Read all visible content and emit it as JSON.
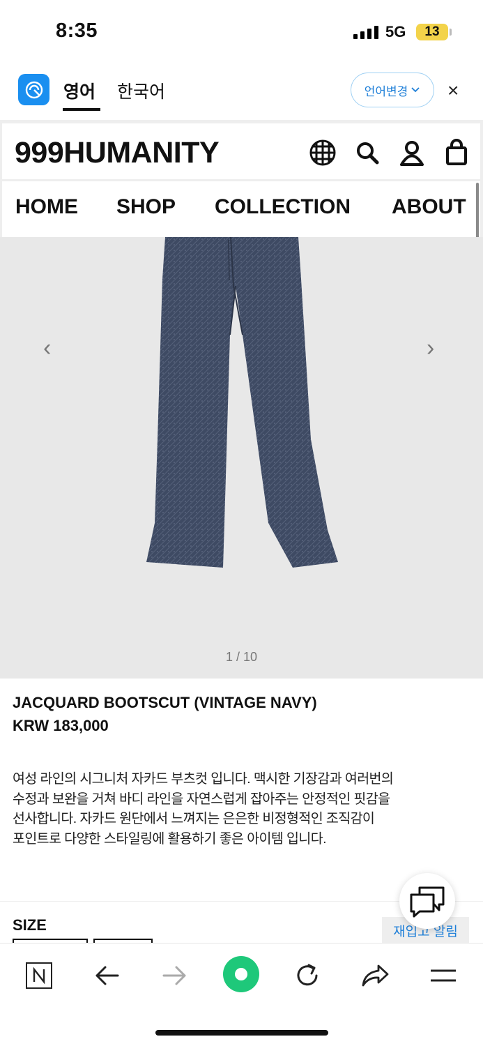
{
  "status": {
    "time": "8:35",
    "network": "5G",
    "battery": "13"
  },
  "translate_bar": {
    "tab_english": "영어",
    "tab_korean": "한국어",
    "change_language": "언어변경",
    "close": "×",
    "accent_color": "#1a8ff0"
  },
  "site": {
    "brand": "999HUMANITY",
    "icons": [
      "globe-grid-icon",
      "search-icon",
      "account-icon",
      "bag-icon"
    ],
    "nav": [
      "HOME",
      "SHOP",
      "COLLECTION",
      "ABOUT"
    ]
  },
  "gallery": {
    "prev": "‹",
    "next": "›",
    "pager": "1 / 10",
    "current": 1,
    "total": 10
  },
  "product": {
    "title": "JACQUARD BOOTSCUT (VINTAGE NAVY)",
    "price": "KRW 183,000",
    "description_lines": [
      "여성 라인의 시그니처 자카드 부츠컷 입니다. 맥시한 기장감과 여러번의",
      "수정과 보완을 거쳐 바디 라인을 자연스럽게 잡아주는 안정적인 핏감을",
      "선사합니다. 자카드 원단에서 느껴지는 은은한 비정형적인 조직감이",
      "포인트로 다양한 스타일링에 활용하기 좋은 아이템 입니다."
    ],
    "size_label": "SIZE"
  },
  "restock_label": "재입고 알림",
  "toolbar_icons": [
    "naver-n-icon",
    "back-arrow-icon",
    "forward-arrow-icon",
    "green-home-icon",
    "reload-icon",
    "share-icon",
    "menu-icon"
  ]
}
